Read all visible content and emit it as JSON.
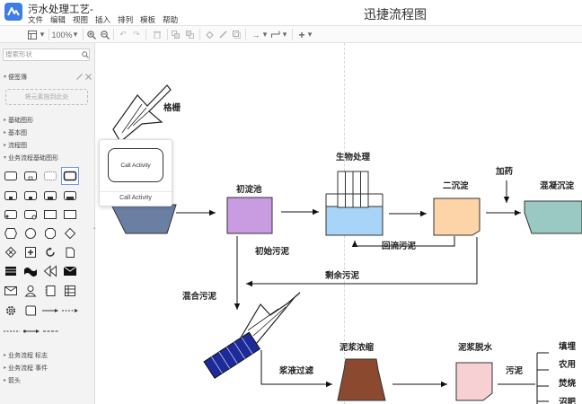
{
  "header": {
    "doc_title": "污水处理工艺-",
    "app_title": "迅捷流程图",
    "menu": [
      "文件",
      "编辑",
      "视图",
      "插入",
      "排列",
      "模板",
      "帮助"
    ]
  },
  "toolbar": {
    "zoom": "100%",
    "items": [
      "page-layout-icon",
      "zoom-in-icon",
      "zoom-out-icon",
      "undo-icon",
      "redo-icon",
      "delete-icon",
      "to-front-icon",
      "to-back-icon",
      "fill-color-icon",
      "line-color-icon",
      "shadow-icon",
      "connector-icon",
      "waypoint-icon",
      "insert-icon"
    ]
  },
  "sidebar": {
    "search_placeholder": "搜索形状",
    "scratchpad": "便签簿",
    "scratchpad_drop": "将元素拖到此处",
    "sections": [
      "基础图形",
      "基本图",
      "流程图",
      "业务流程基础图形"
    ],
    "bottom_sections": [
      "业务流程 标志",
      "业务流程 事件",
      "箭头"
    ]
  },
  "popup": {
    "shape_text": "Call Activity",
    "name": "Call Activity"
  },
  "diagram": {
    "labels": {
      "grille": "格栅",
      "primary_tank": "初淀池",
      "bio": "生物处理",
      "secondary_tank": "二沉淀",
      "dosing": "加药",
      "coag_tank": "混凝沉淀",
      "initial_sludge": "初始污泥",
      "return_sludge": "回流污泥",
      "excess_sludge": "剩余污泥",
      "mixed_sludge": "混合污泥",
      "thickening": "泥浆浓缩",
      "dewatering": "泥浆脱水",
      "slurry_filter": "浆液过滤",
      "sludge": "污泥",
      "out1": "填埋",
      "out2": "农用",
      "out3": "焚烧",
      "out4": "沼肥"
    },
    "colors": {
      "primary_tank": "#c99be0",
      "bio_tank": "#a7d4f7",
      "secondary_tank": "#fdd3a8",
      "coag_tank": "#99c9c2",
      "screen": "#6b7fa3",
      "conveyor": "#1c2a9a",
      "thickener": "#8b4a30",
      "dewater": "#f7d0d3"
    }
  }
}
